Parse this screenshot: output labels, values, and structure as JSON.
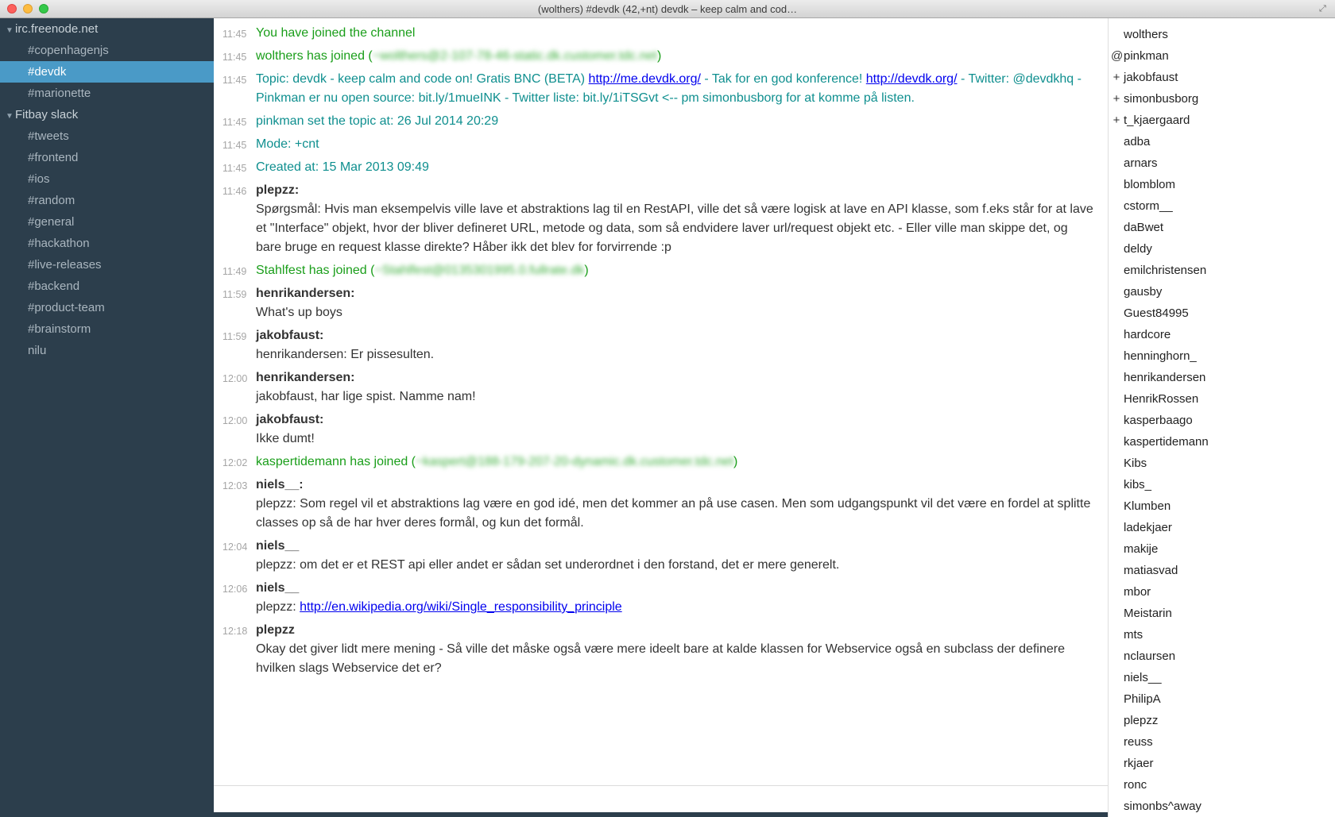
{
  "window": {
    "title": "(wolthers) #devdk (42,+nt) devdk – keep calm and cod…"
  },
  "sidebar": {
    "servers": [
      {
        "name": "irc.freenode.net",
        "channels": [
          "#copenhagenjs",
          "#devdk",
          "#marionette"
        ],
        "active": "#devdk"
      },
      {
        "name": "Fitbay slack",
        "channels": [
          "#tweets",
          "#frontend",
          "#ios",
          "#random",
          "#general",
          "#hackathon",
          "#live-releases",
          "#backend",
          "#product-team",
          "#brainstorm",
          "nilu"
        ]
      }
    ]
  },
  "log": [
    {
      "ts": "11:45",
      "text": "You have joined the channel"
    },
    {
      "ts": "11:45",
      "pre": "wolthers has joined (",
      "blurred": "~wolthers@2-107-78-46-static.dk.customer.tdc.net",
      "post": ")"
    },
    {
      "ts": "11:45",
      "t1": "Topic: devdk - keep calm and code on! Gratis BNC (BETA) ",
      "l1": "http://me.devdk.org/",
      "t2": " - Tak for en god konference! ",
      "l2": "http://devdk.org/",
      "t3": " - Twitter: @devdkhq - Pinkman er nu open source: bit.ly/1mueINK - Twitter liste: bit.ly/1iTSGvt <-- pm simonbusborg for at komme på listen."
    },
    {
      "ts": "11:45",
      "text": "pinkman set the topic at: 26 Jul 2014 20:29"
    },
    {
      "ts": "11:45",
      "text": "Mode: +cnt"
    },
    {
      "ts": "11:45",
      "text": "Created at: 15 Mar 2013 09:49"
    },
    {
      "ts": "11:46",
      "nick": "plepzz:",
      "text": "Spørgsmål: Hvis man eksempelvis ville lave et abstraktions lag til en RestAPI, ville det så være logisk at lave en API klasse, som f.eks står for at lave et \"Interface\" objekt, hvor der bliver defineret URL, metode og data, som så endvidere laver url/request objekt etc. - Eller ville man skippe det, og bare bruge en request klasse direkte? Håber ikk det blev for forvirrende :p"
    },
    {
      "ts": "11:49",
      "pre": "Stahlfest has joined (",
      "blurred": "~Stahlfest@0135301995.0.fullrate.dk",
      "post": ")"
    },
    {
      "ts": "11:59",
      "nick": "henrikandersen:",
      "text": "What's up boys"
    },
    {
      "ts": "11:59",
      "nick": "jakobfaust:",
      "text": "henrikandersen: Er pissesulten."
    },
    {
      "ts": "12:00",
      "nick": "henrikandersen:",
      "text": "jakobfaust, har lige spist. Namme nam!"
    },
    {
      "ts": "12:00",
      "nick": "jakobfaust:",
      "text": "Ikke dumt!"
    },
    {
      "ts": "12:02",
      "pre": "kaspertidemann has joined (",
      "blurred": "~kaspert@188-179-207-20-dynamic.dk.customer.tdc.net",
      "post": ")"
    },
    {
      "ts": "12:03",
      "nick": "niels__:",
      "text": "plepzz: Som regel vil et abstraktions lag være en god idé, men det kommer an på use casen. Men som udgangspunkt vil det være en fordel at splitte classes op så de har hver deres formål, og kun det formål."
    },
    {
      "ts": "12:04",
      "nick": "niels__",
      "text": "plepzz: om det er et REST api eller andet er sådan set underordnet i den forstand, det er mere generelt."
    },
    {
      "ts": "12:06",
      "nick": "niels__",
      "pre": "plepzz: ",
      "link": "http://en.wikipedia.org/wiki/Single_responsibility_principle"
    },
    {
      "ts": "12:18",
      "nick": "plepzz",
      "text": "Okay det giver lidt mere mening - Så ville det måske også være mere ideelt bare at kalde klassen for Webservice også en subclass der definere hvilken slags Webservice det er?"
    }
  ],
  "nicklist": [
    {
      "prefix": "",
      "name": "wolthers"
    },
    {
      "prefix": "@",
      "name": "pinkman"
    },
    {
      "prefix": "+",
      "name": "jakobfaust"
    },
    {
      "prefix": "+",
      "name": "simonbusborg"
    },
    {
      "prefix": "+",
      "name": "t_kjaergaard"
    },
    {
      "prefix": "",
      "name": "adba"
    },
    {
      "prefix": "",
      "name": "arnars"
    },
    {
      "prefix": "",
      "name": "blomblom"
    },
    {
      "prefix": "",
      "name": "cstorm__"
    },
    {
      "prefix": "",
      "name": "daBwet"
    },
    {
      "prefix": "",
      "name": "deldy"
    },
    {
      "prefix": "",
      "name": "emilchristensen"
    },
    {
      "prefix": "",
      "name": "gausby"
    },
    {
      "prefix": "",
      "name": "Guest84995"
    },
    {
      "prefix": "",
      "name": "hardcore"
    },
    {
      "prefix": "",
      "name": "henninghorn_"
    },
    {
      "prefix": "",
      "name": "henrikandersen"
    },
    {
      "prefix": "",
      "name": "HenrikRossen"
    },
    {
      "prefix": "",
      "name": "kasperbaago"
    },
    {
      "prefix": "",
      "name": "kaspertidemann"
    },
    {
      "prefix": "",
      "name": "Kibs"
    },
    {
      "prefix": "",
      "name": "kibs_"
    },
    {
      "prefix": "",
      "name": "Klumben"
    },
    {
      "prefix": "",
      "name": "ladekjaer"
    },
    {
      "prefix": "",
      "name": "makije"
    },
    {
      "prefix": "",
      "name": "matiasvad"
    },
    {
      "prefix": "",
      "name": "mbor"
    },
    {
      "prefix": "",
      "name": "Meistarin"
    },
    {
      "prefix": "",
      "name": "mts"
    },
    {
      "prefix": "",
      "name": "nclaursen"
    },
    {
      "prefix": "",
      "name": "niels__"
    },
    {
      "prefix": "",
      "name": "PhilipA"
    },
    {
      "prefix": "",
      "name": "plepzz"
    },
    {
      "prefix": "",
      "name": "reuss"
    },
    {
      "prefix": "",
      "name": "rkjaer"
    },
    {
      "prefix": "",
      "name": "ronc"
    },
    {
      "prefix": "",
      "name": "simonbs^away"
    }
  ]
}
